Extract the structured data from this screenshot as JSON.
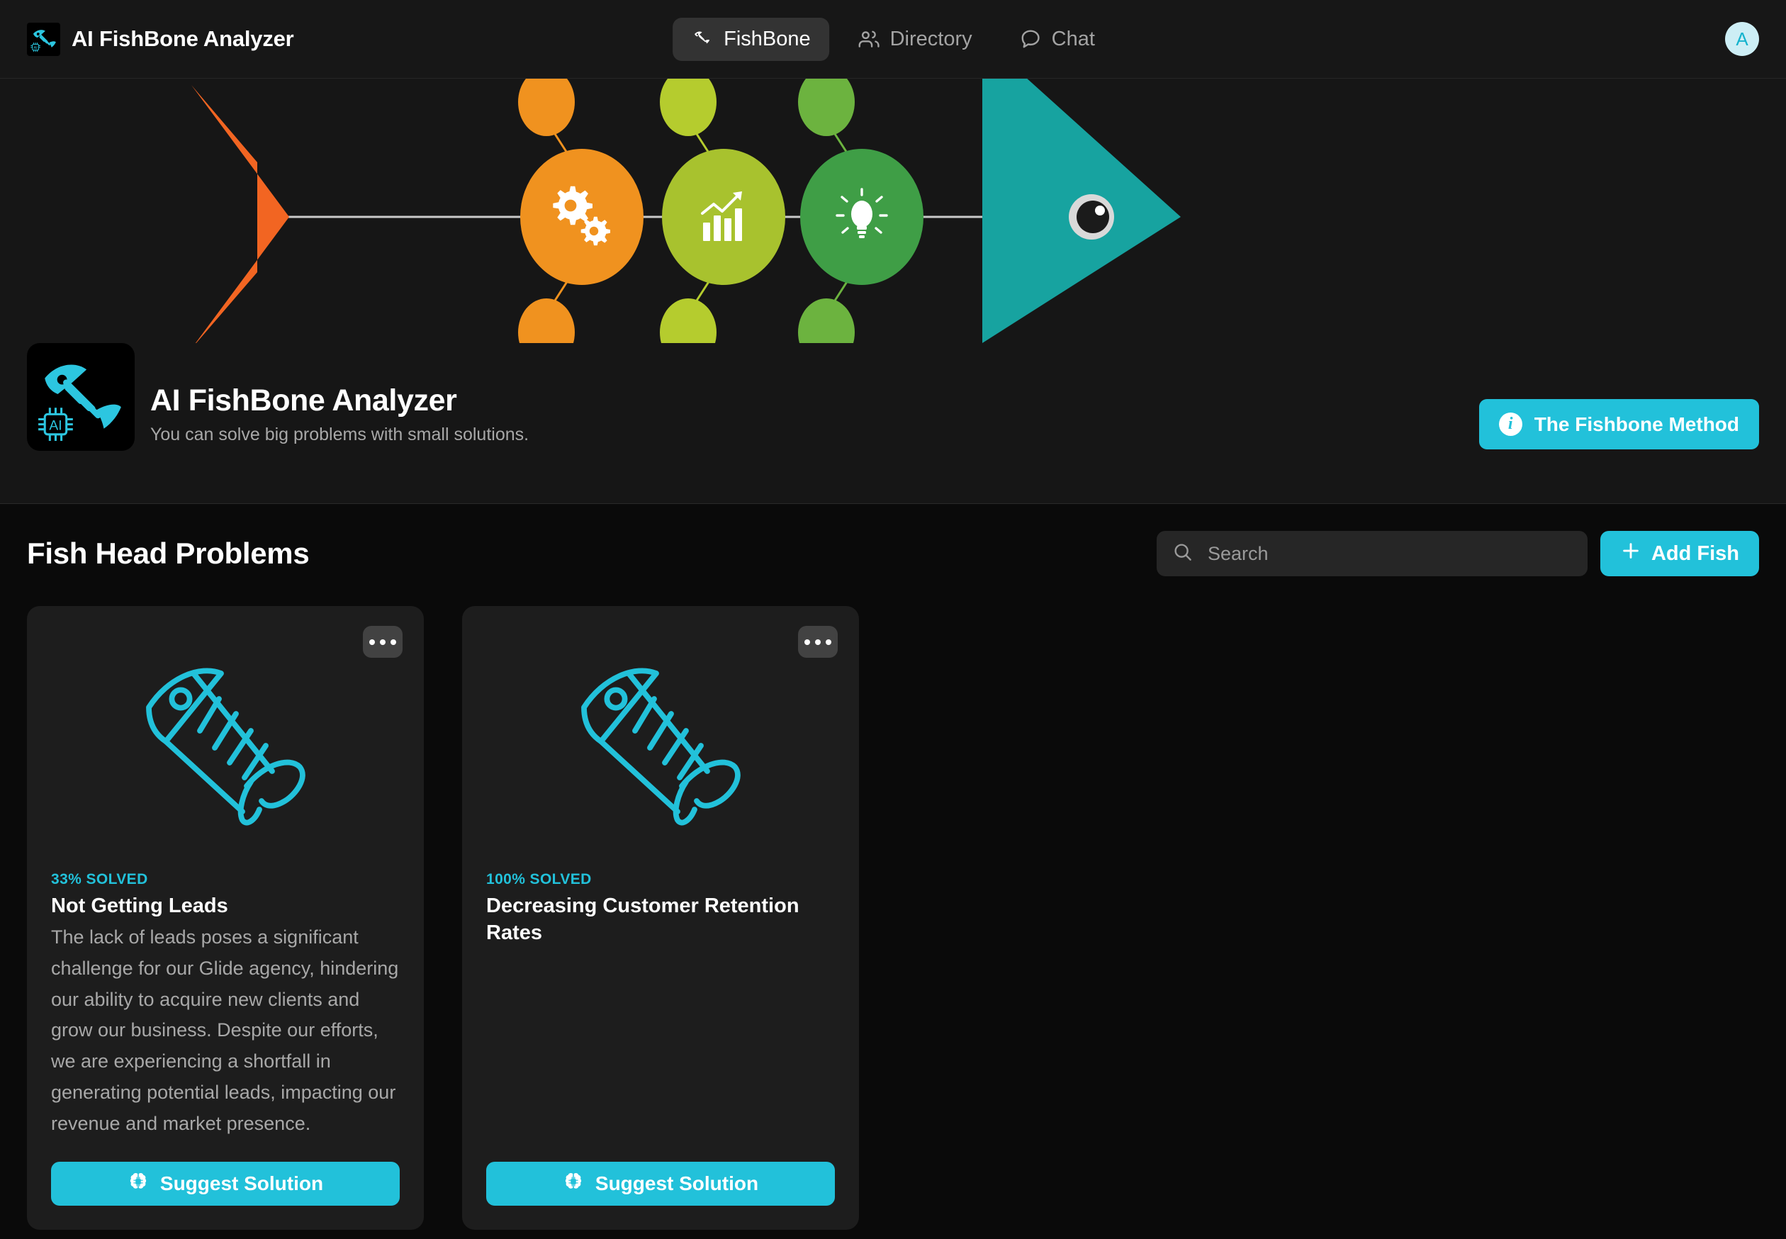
{
  "colors": {
    "accent": "#22c1da",
    "page_bg": "#0a0a0a",
    "header_bg": "#171717",
    "hero_bg": "#161616",
    "card_bg": "#1d1d1d",
    "fish_tail_orange": "#f26522",
    "bone_orange": "#f0921f",
    "bone_yellowgreen": "#b5cc2e",
    "bone_green": "#4a9e45",
    "fish_head_teal": "#17a3a0",
    "avatar_bg": "#cdeef5"
  },
  "header": {
    "brand_title": "AI FishBone Analyzer",
    "brand_icon": "fishbone-logo-icon",
    "tabs": [
      {
        "label": "FishBone",
        "icon": "fishbone-icon",
        "active": true
      },
      {
        "label": "Directory",
        "icon": "people-icon",
        "active": false
      },
      {
        "label": "Chat",
        "icon": "chat-bubble-icon",
        "active": false
      }
    ],
    "avatar_initial": "A"
  },
  "hero": {
    "app_icon": "ai-fishbone-app-icon",
    "title": "AI FishBone Analyzer",
    "subtitle": "You can solve big problems with small solutions.",
    "method_button": {
      "label": "The Fishbone Method",
      "icon": "info-icon"
    },
    "diagram": {
      "nodes": [
        {
          "icon": "gears-icon",
          "color": "#f0921f"
        },
        {
          "icon": "bar-chart-growth-icon",
          "color": "#a8c22e"
        },
        {
          "icon": "lightbulb-icon",
          "color": "#4a9e45"
        }
      ],
      "tail_color": "#f26522",
      "head_color": "#17a3a0"
    }
  },
  "main": {
    "section_title": "Fish Head Problems",
    "search": {
      "placeholder": "Search",
      "value": "",
      "icon": "search-icon"
    },
    "add_button": {
      "label": "Add Fish",
      "icon": "plus-icon"
    },
    "cards": [
      {
        "status": "33% SOLVED",
        "title": "Not Getting Leads",
        "description": "The lack of leads poses a significant challenge for our Glide agency, hindering our ability to acquire new clients and grow our business. Despite our efforts, we are experiencing a shortfall in generating potential leads, impacting our revenue and market presence.",
        "art_icon": "fishbone-outline-icon",
        "menu_icon": "more-options-icon",
        "action": {
          "label": "Suggest Solution",
          "icon": "ai-brain-chip-icon"
        }
      },
      {
        "status": "100% SOLVED",
        "title": "Decreasing Customer Retention Rates",
        "description": "",
        "art_icon": "fishbone-outline-icon",
        "menu_icon": "more-options-icon",
        "action": {
          "label": "Suggest Solution",
          "icon": "ai-brain-chip-icon"
        }
      }
    ]
  }
}
